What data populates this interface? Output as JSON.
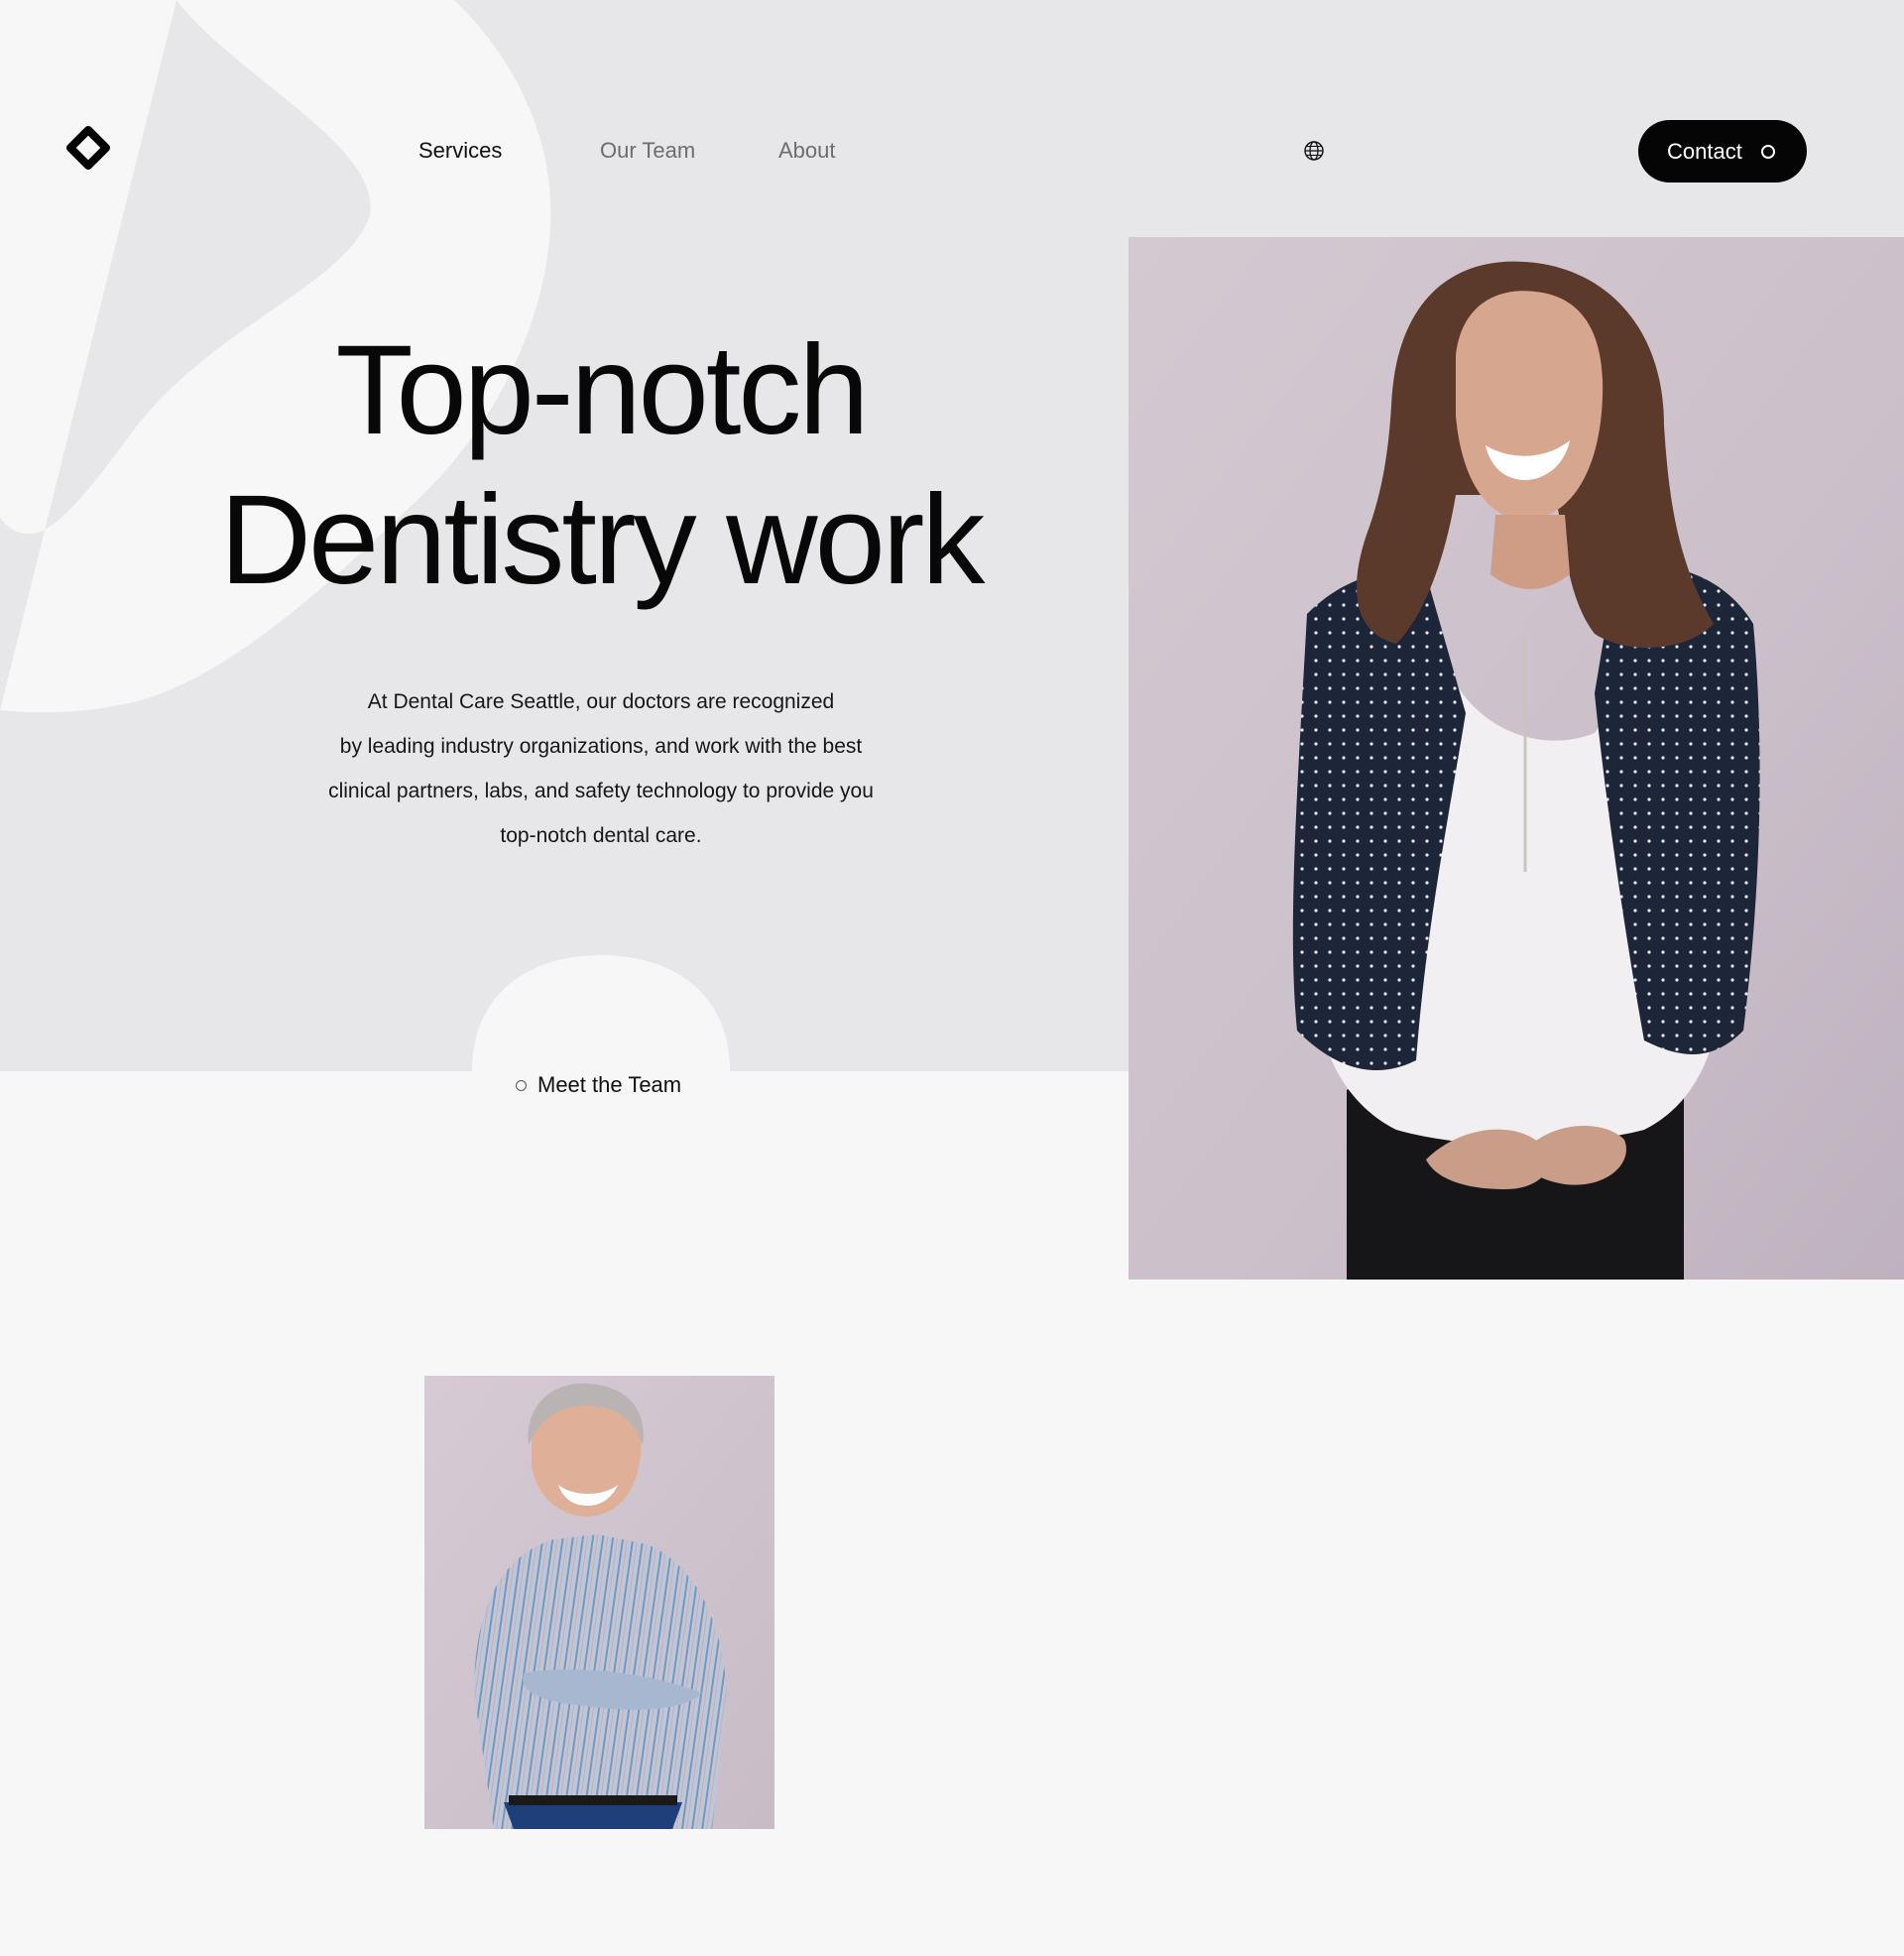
{
  "nav": {
    "items": [
      {
        "label": "Services",
        "active": true
      },
      {
        "label": "Our Team",
        "active": false
      },
      {
        "label": "About",
        "active": false
      }
    ],
    "language_icon": "globe-icon",
    "contact_label": "Contact"
  },
  "hero": {
    "title_lines": [
      "Top-notch",
      "Dentistry work"
    ],
    "intro_lines": [
      "At Dental Care Seattle, our doctors are recognized",
      "by leading industry organizations, and work with the best",
      "clinical partners, labs, and safety technology to provide you",
      "top-notch dental care."
    ],
    "cta_label": "Meet the Team"
  },
  "colors": {
    "hero_background": "#e7e7e9",
    "page_background": "#f7f7f7",
    "accent": "#050505",
    "photo_backdrop": "#cdbfcb"
  }
}
